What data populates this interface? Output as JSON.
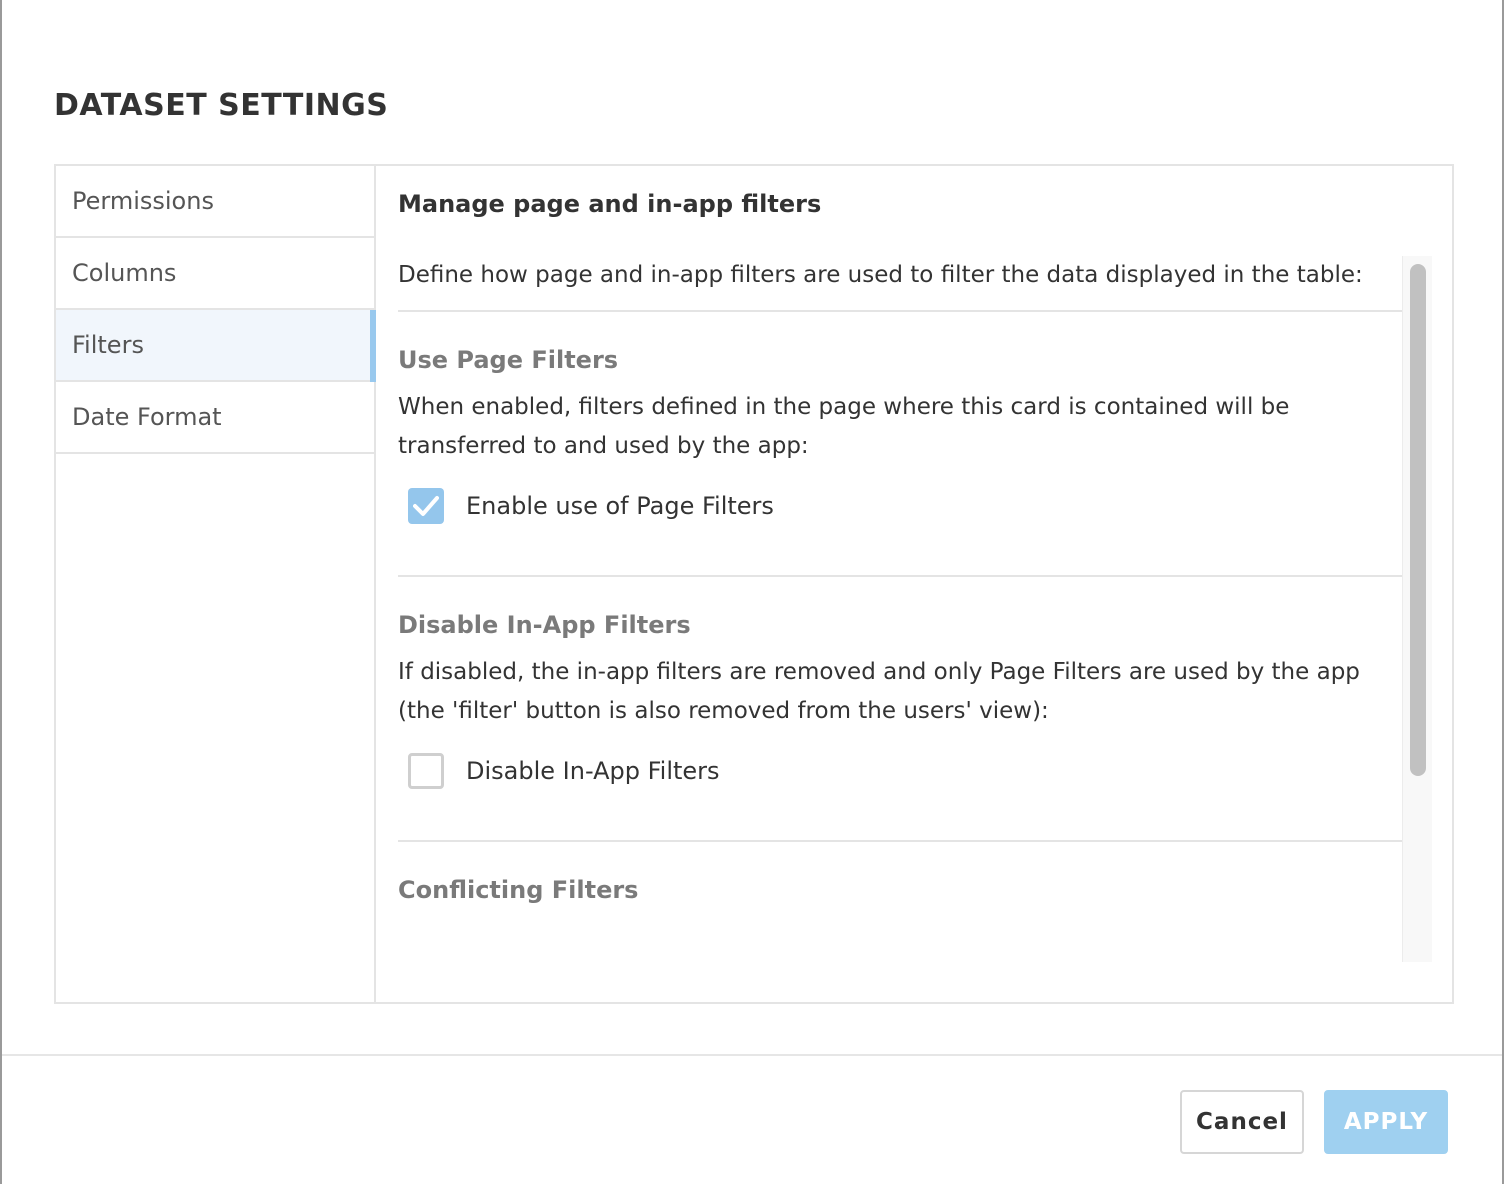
{
  "modal": {
    "title": "DATASET SETTINGS"
  },
  "sidebar": {
    "items": [
      {
        "label": "Permissions",
        "active": false
      },
      {
        "label": "Columns",
        "active": false
      },
      {
        "label": "Filters",
        "active": true
      },
      {
        "label": "Date Format",
        "active": false
      }
    ]
  },
  "content": {
    "heading": "Manage page and in-app filters",
    "intro": "Define how page and in-app filters are used to filter the data displayed in the table:",
    "sections": [
      {
        "title": "Use Page Filters",
        "description_line1": "When enabled, filters defined in the page where this card is contained will be",
        "description_line2": "transferred to and used by the app:",
        "checkbox_label": "Enable use of Page Filters",
        "checked": true
      },
      {
        "title": "Disable In-App Filters",
        "description_line1": "If disabled, the in-app filters are removed and only Page Filters are used by the app",
        "description_line2": "(the 'filter' button is also removed from the users' view):",
        "checkbox_label": "Disable In-App Filters",
        "checked": false
      },
      {
        "title": "Conflicting Filters"
      }
    ]
  },
  "footer": {
    "cancel_label": "Cancel",
    "apply_label": "APPLY"
  },
  "colors": {
    "accent": "#94c6ec",
    "apply_button": "#9fd0f0",
    "active_tab_bg": "#f1f6fc",
    "section_title": "#7a7a7a"
  },
  "icons": {
    "checked_checkbox": "checkmark-icon"
  }
}
